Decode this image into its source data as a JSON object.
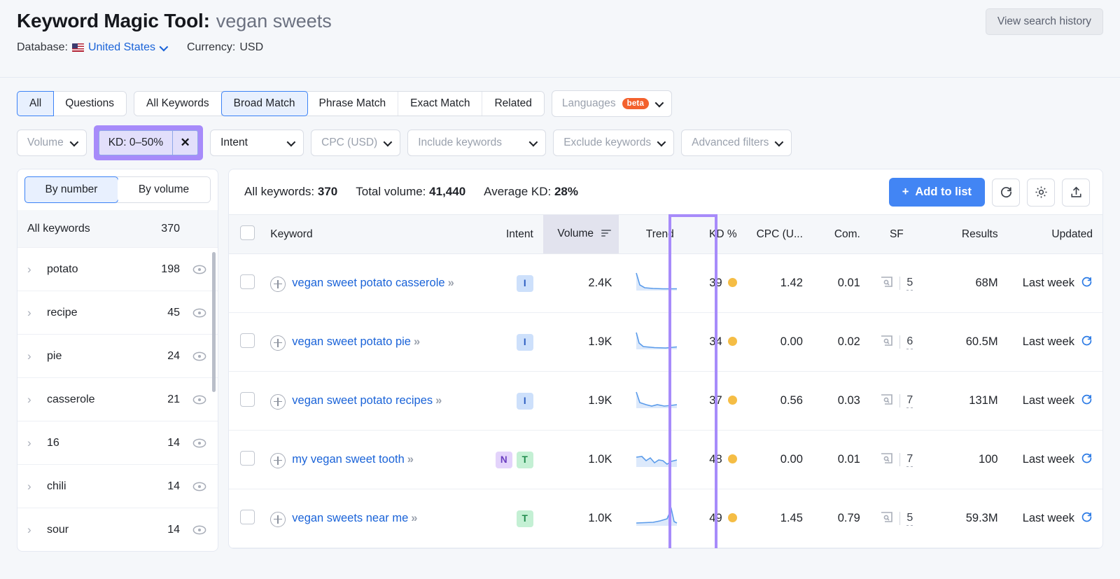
{
  "header": {
    "title_main": "Keyword Magic Tool:",
    "keyword": "vegan sweets",
    "database_label": "Database:",
    "database_value": "United States",
    "currency_label": "Currency:",
    "currency_value": "USD",
    "view_history_label": "View search history"
  },
  "filters": {
    "question_tabs": [
      {
        "label": "All",
        "active": true
      },
      {
        "label": "Questions",
        "active": false
      }
    ],
    "match_tabs": [
      {
        "label": "All Keywords",
        "active": false
      },
      {
        "label": "Broad Match",
        "active": true
      },
      {
        "label": "Phrase Match",
        "active": false
      },
      {
        "label": "Exact Match",
        "active": false
      },
      {
        "label": "Related",
        "active": false
      }
    ],
    "languages_label": "Languages",
    "languages_badge": "beta",
    "volume_label": "Volume",
    "kd_chip_label": "KD: 0–50%",
    "kd_chip_close": "✕",
    "intent_label": "Intent",
    "cpc_label": "CPC (USD)",
    "include_label": "Include keywords",
    "exclude_label": "Exclude keywords",
    "advanced_label": "Advanced filters"
  },
  "sidebar": {
    "toggle": [
      {
        "label": "By number",
        "active": true
      },
      {
        "label": "By volume",
        "active": false
      }
    ],
    "all_keywords_label": "All keywords",
    "all_keywords_count": "370",
    "items": [
      {
        "name": "potato",
        "count": "198"
      },
      {
        "name": "recipe",
        "count": "45"
      },
      {
        "name": "pie",
        "count": "24"
      },
      {
        "name": "casserole",
        "count": "21"
      },
      {
        "name": "16",
        "count": "14"
      },
      {
        "name": "chili",
        "count": "14"
      },
      {
        "name": "sour",
        "count": "14"
      }
    ]
  },
  "main": {
    "stats": {
      "all_keywords_label": "All keywords:",
      "all_keywords_value": "370",
      "total_volume_label": "Total volume:",
      "total_volume_value": "41,440",
      "average_kd_label": "Average KD:",
      "average_kd_value": "28%"
    },
    "add_to_list_label": "Add to list",
    "add_to_list_plus": "+",
    "columns": {
      "keyword": "Keyword",
      "intent": "Intent",
      "volume": "Volume",
      "trend": "Trend",
      "kd": "KD %",
      "cpc": "CPC (U...",
      "com": "Com.",
      "sf": "SF",
      "results": "Results",
      "updated": "Updated"
    },
    "rows": [
      {
        "keyword": "vegan sweet potato casserole",
        "intent": [
          "I"
        ],
        "volume": "2.4K",
        "trend": "decline-flat",
        "kd": "39",
        "cpc": "1.42",
        "com": "0.01",
        "sf": "5",
        "results": "68M",
        "updated": "Last week"
      },
      {
        "keyword": "vegan sweet potato pie",
        "intent": [
          "I"
        ],
        "volume": "1.9K",
        "trend": "decline-flat",
        "kd": "34",
        "cpc": "0.00",
        "com": "0.02",
        "sf": "6",
        "results": "60.5M",
        "updated": "Last week"
      },
      {
        "keyword": "vegan sweet potato recipes",
        "intent": [
          "I"
        ],
        "volume": "1.9K",
        "trend": "decline-wobble",
        "kd": "37",
        "cpc": "0.56",
        "com": "0.03",
        "sf": "7",
        "results": "131M",
        "updated": "Last week"
      },
      {
        "keyword": "my vegan sweet tooth",
        "intent": [
          "N",
          "T"
        ],
        "volume": "1.0K",
        "trend": "wavy",
        "kd": "48",
        "cpc": "0.00",
        "com": "0.01",
        "sf": "7",
        "results": "100",
        "updated": "Last week"
      },
      {
        "keyword": "vegan sweets near me",
        "intent": [
          "T"
        ],
        "volume": "1.0K",
        "trend": "flat-spike",
        "kd": "49",
        "cpc": "1.45",
        "com": "0.79",
        "sf": "5",
        "results": "59.3M",
        "updated": "Last week"
      }
    ]
  },
  "colors": {
    "accent_blue": "#4285f4",
    "link_blue": "#1a63d8",
    "annotation_purple": "#a78bfa",
    "kd_dot_orange": "#f5bd45",
    "beta_orange": "#f3612d"
  }
}
